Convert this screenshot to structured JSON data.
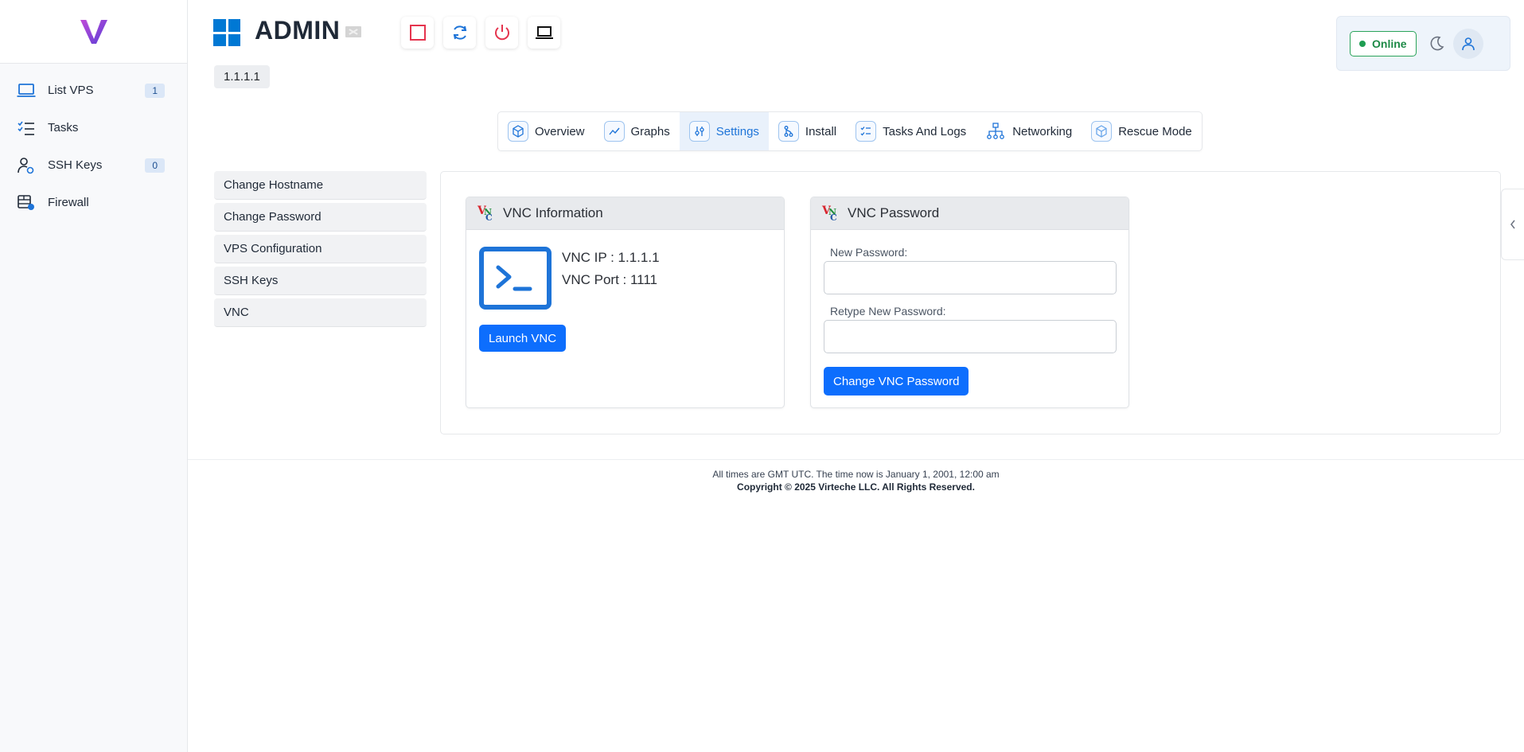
{
  "sidebar": {
    "items": [
      {
        "label": "List VPS",
        "badge": "1"
      },
      {
        "label": "Tasks",
        "badge": ""
      },
      {
        "label": "SSH Keys",
        "badge": "0"
      },
      {
        "label": "Firewall",
        "badge": ""
      }
    ]
  },
  "header": {
    "server_name": "ADMIN",
    "ip": "1.1.1.1",
    "status": "Online"
  },
  "tabs": [
    {
      "label": "Overview"
    },
    {
      "label": "Graphs"
    },
    {
      "label": "Settings",
      "active": true
    },
    {
      "label": "Install"
    },
    {
      "label": "Tasks And Logs"
    },
    {
      "label": "Networking"
    },
    {
      "label": "Rescue Mode"
    }
  ],
  "settings_menu": [
    {
      "label": "Change Hostname"
    },
    {
      "label": "Change Password"
    },
    {
      "label": "VPS Configuration"
    },
    {
      "label": "SSH Keys"
    },
    {
      "label": "VNC"
    }
  ],
  "vnc_info": {
    "title": "VNC Information",
    "ip_line": "VNC IP : 1.1.1.1",
    "port_line": "VNC Port : 1111",
    "launch_label": "Launch VNC"
  },
  "vnc_password": {
    "title": "VNC Password",
    "new_label": "New Password:",
    "new_value": "",
    "retype_label": "Retype New Password:",
    "retype_value": "",
    "button_label": "Change VNC Password"
  },
  "footer": {
    "time_text": "All times are GMT UTC. The time now is January 1, 2001, 12:00 am",
    "copyright": "Copyright © 2025 Virteche LLC. All Rights Reserved."
  },
  "colors": {
    "primary": "#0d6efd",
    "accent": "#1e74d8",
    "online": "#1e8a47",
    "danger": "#e5344e"
  }
}
